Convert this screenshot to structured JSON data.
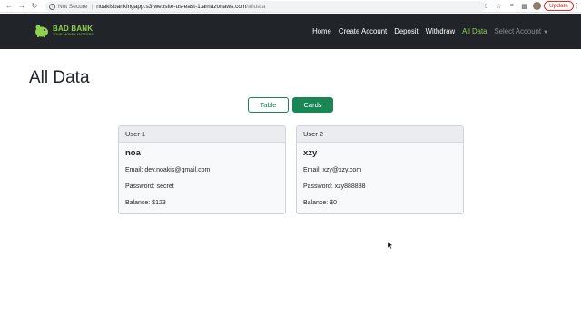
{
  "browser": {
    "security_label": "Not Secure",
    "separator": "|",
    "url_host": "noakisbankingapp.s3-website-us-east-1.amazonaws.com",
    "url_path": "/alldata",
    "update_label": "Update"
  },
  "navbar": {
    "brand_name": "BAD BANK",
    "brand_tagline": "YOUR MONEY MATTERS",
    "links": [
      "Home",
      "Create Account",
      "Deposit",
      "Withdraw",
      "All Data",
      "Select Account"
    ],
    "active_color": "#8fd14f"
  },
  "page": {
    "title": "All Data",
    "toggle": {
      "table_label": "Table",
      "cards_label": "Cards"
    }
  },
  "cards": [
    {
      "header": "User 1",
      "name": "noa",
      "email": "Email: dev.noakis@gmail.com",
      "password": "Password: secret",
      "balance": "Balance: $123"
    },
    {
      "header": "User 2",
      "name": "xzy",
      "email": "Email: xzy@xzy.com",
      "password": "Password: xzy888888",
      "balance": "Balance: $0"
    }
  ],
  "colors": {
    "navbar_bg": "#212529",
    "success": "#198754"
  }
}
